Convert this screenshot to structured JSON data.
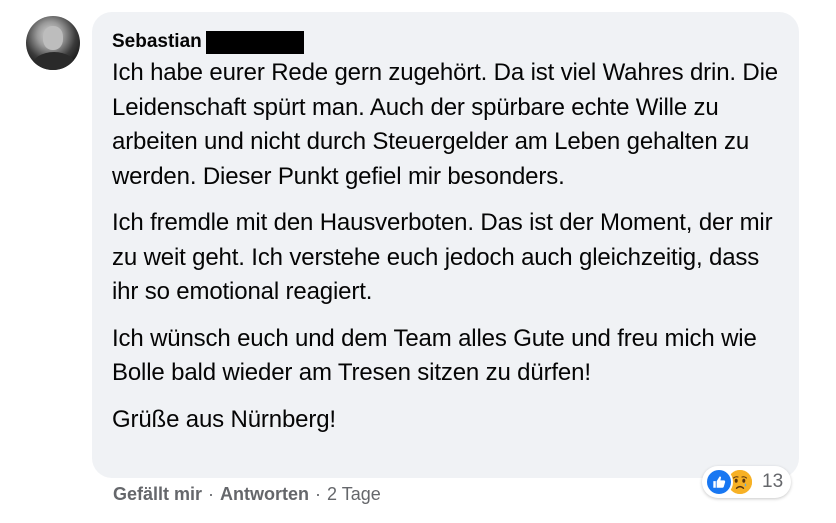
{
  "comment": {
    "author": "Sebastian",
    "paragraphs": [
      "Ich habe eurer Rede gern zugehört. Da ist viel Wahres drin. Die Leidenschaft spürt man. Auch der spürbare echte Wille zu arbeiten und nicht durch Steuergelder am Leben gehalten zu werden. Dieser Punkt gefiel mir besonders.",
      "Ich fremdle mit den Hausverboten. Das ist der Moment, der mir zu weit geht. Ich verstehe euch jedoch auch gleichzeitig, dass ihr so emotional reagiert.",
      "Ich wünsch euch und dem Team alles Gute und freu mich wie Bolle bald wieder am Tresen sitzen zu dürfen!",
      "Grüße aus Nürnberg!"
    ],
    "reactions": {
      "icons": [
        "like-icon",
        "sad-icon"
      ],
      "count": "13"
    }
  },
  "actions": {
    "like_label": "Gefällt mir",
    "reply_label": "Antworten",
    "separator": "·",
    "timestamp": "2 Tage"
  },
  "colors": {
    "bubble_bg": "#f0f2f5",
    "text": "#050505",
    "meta_text": "#65676b",
    "like_blue": "#1877f2",
    "sad_yellow": "#f7b125"
  }
}
